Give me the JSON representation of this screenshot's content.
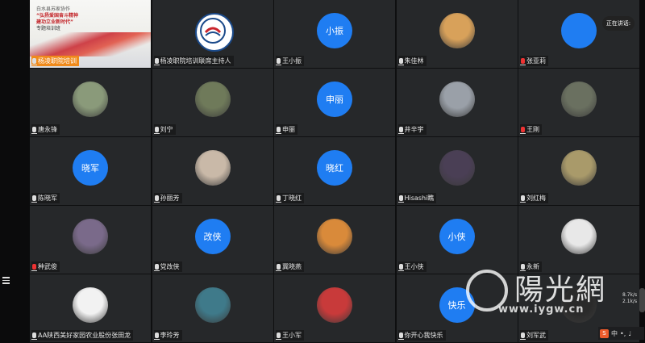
{
  "meeting": {
    "speaking_label": "正在讲话:",
    "watermark_text": "陽光網",
    "watermark_url": "www.iygw.cn",
    "ime_label": "中",
    "net_up": "8.7k/s",
    "net_down": "2.1k/s"
  },
  "banner": {
    "line1": "白水县苏家协作",
    "line2": "“弘扬爱国奋斗精神",
    "line3": "建功立业新时代”",
    "line4": "专题培训班"
  },
  "participants": [
    {
      "name": "杨凌职院培训",
      "avatar": "banner",
      "mic": "on",
      "host": true
    },
    {
      "name": "杨凌职院培训联席主持人",
      "avatar": "logo",
      "mic": "on"
    },
    {
      "name": "王小振",
      "avatar": "text",
      "avatar_text": "小振",
      "mic": "on"
    },
    {
      "name": "朱佳林",
      "avatar": "photo",
      "photo_color": "#d8a15a",
      "mic": "on"
    },
    {
      "name": "张亚莉",
      "avatar": "text",
      "avatar_text": "",
      "mic": "off",
      "speaking": true
    },
    {
      "name": "唐永锋",
      "avatar": "photo",
      "photo_color": "#8a9a7a",
      "mic": "on"
    },
    {
      "name": "刘宁",
      "avatar": "photo",
      "photo_color": "#6f7a5a",
      "mic": "on"
    },
    {
      "name": "申丽",
      "avatar": "text",
      "avatar_text": "申丽",
      "mic": "on"
    },
    {
      "name": "井辛宇",
      "avatar": "photo",
      "photo_color": "#9aa0a8",
      "mic": "on"
    },
    {
      "name": "王刚",
      "avatar": "photo",
      "photo_color": "#6a7060",
      "mic": "off"
    },
    {
      "name": "陈晓军",
      "avatar": "text",
      "avatar_text": "晓军",
      "mic": "on"
    },
    {
      "name": "孙丽芳",
      "avatar": "photo",
      "photo_color": "#c9b9a8",
      "mic": "on"
    },
    {
      "name": "丁晓红",
      "avatar": "text",
      "avatar_text": "晓红",
      "mic": "on"
    },
    {
      "name": "Hisashi瞧",
      "avatar": "photo",
      "photo_color": "#4a3f55",
      "mic": "on"
    },
    {
      "name": "刘红梅",
      "avatar": "photo",
      "photo_color": "#a99a6a",
      "mic": "on"
    },
    {
      "name": "种武俊",
      "avatar": "photo",
      "photo_color": "#7a6a8a",
      "mic": "off"
    },
    {
      "name": "党改侠",
      "avatar": "text",
      "avatar_text": "改侠",
      "mic": "on"
    },
    {
      "name": "冀晓燕",
      "avatar": "photo",
      "photo_color": "#d98a3a",
      "mic": "on"
    },
    {
      "name": "王小侠",
      "avatar": "text",
      "avatar_text": "小侠",
      "mic": "on"
    },
    {
      "name": "永新",
      "avatar": "photo",
      "photo_color": "#e8e8e8",
      "mic": "on"
    },
    {
      "name": "AA陕西美好家园农业股份张田龙",
      "avatar": "photo",
      "photo_color": "#f2f2f2",
      "mic": "on"
    },
    {
      "name": "李玲芳",
      "avatar": "photo",
      "photo_color": "#3f7a8a",
      "mic": "on"
    },
    {
      "name": "王小军",
      "avatar": "photo",
      "photo_color": "#c83a3a",
      "mic": "on"
    },
    {
      "name": "你开心我快乐",
      "avatar": "text",
      "avatar_text": "快乐",
      "mic": "on"
    },
    {
      "name": "刘军武",
      "avatar": "photo",
      "photo_color": "#2a2a2a",
      "mic": "on"
    }
  ]
}
